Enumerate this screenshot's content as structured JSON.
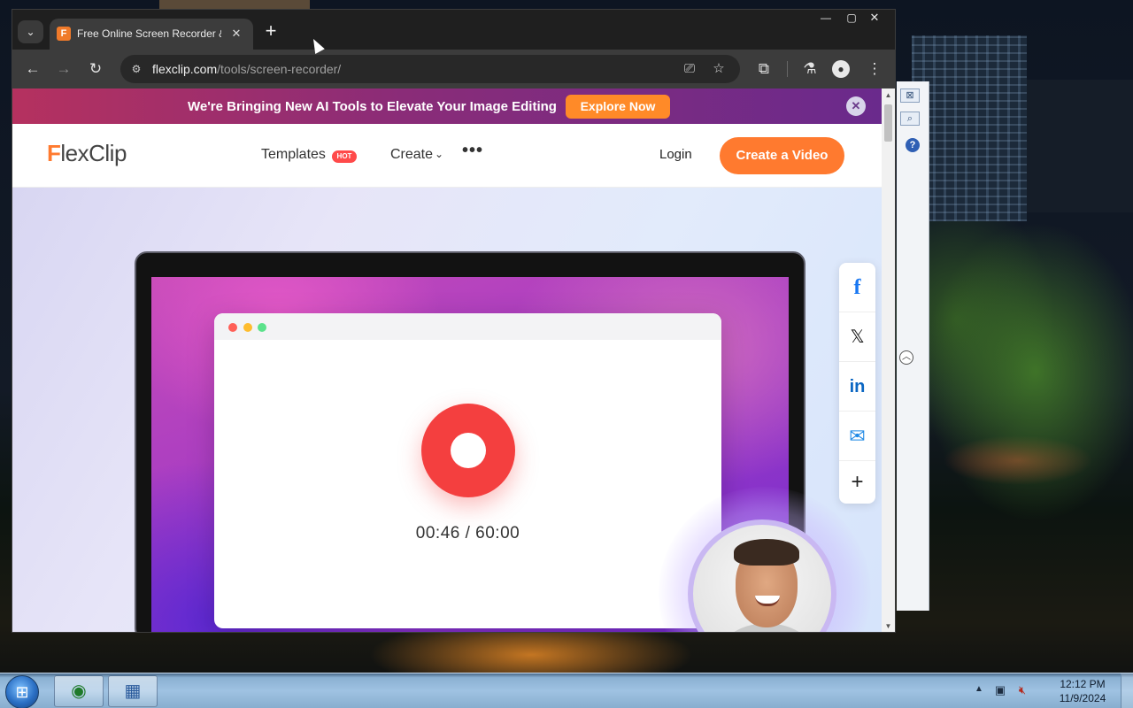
{
  "browser": {
    "tab_title": "Free Online Screen Recorder &",
    "tab_favicon": "F",
    "new_tab_label": "+",
    "url_host": "flexclip.com",
    "url_path": "/tools/screen-recorder/"
  },
  "page": {
    "banner": {
      "message": "We're Bringing New AI Tools to Elevate Your Image Editing",
      "cta": "Explore Now",
      "close": "✕"
    },
    "nav": {
      "logo_prefix": "F",
      "logo_rest": "lexClip",
      "templates": "Templates",
      "hot_badge": "HOT",
      "create": "Create",
      "more": "•••",
      "login": "Login",
      "cta": "Create a Video"
    },
    "recorder": {
      "timer": "00:46 / 60:00"
    },
    "share": {
      "facebook": "f",
      "x": "𝕏",
      "linkedin": "in",
      "email": "✉",
      "more": "+"
    }
  },
  "taskbar": {
    "time": "12:12 PM",
    "date": "11/9/2024"
  },
  "colors": {
    "brand_orange": "#ff7a2f",
    "record_red": "#f43f3f",
    "banner_start": "#b5315f",
    "banner_end": "#6a2a8c"
  },
  "icons": [
    "tab-search-icon",
    "favicon-icon",
    "tab-close-icon",
    "new-tab-icon",
    "back-icon",
    "forward-icon",
    "reload-icon",
    "site-info-icon",
    "install-app-icon",
    "bookmark-star-icon",
    "extensions-icon",
    "labs-flask-icon",
    "profile-icon",
    "menu-kebab-icon",
    "facebook-icon",
    "x-icon",
    "linkedin-icon",
    "email-icon",
    "plus-icon",
    "windows-start-icon",
    "chrome-taskbar-icon"
  ]
}
